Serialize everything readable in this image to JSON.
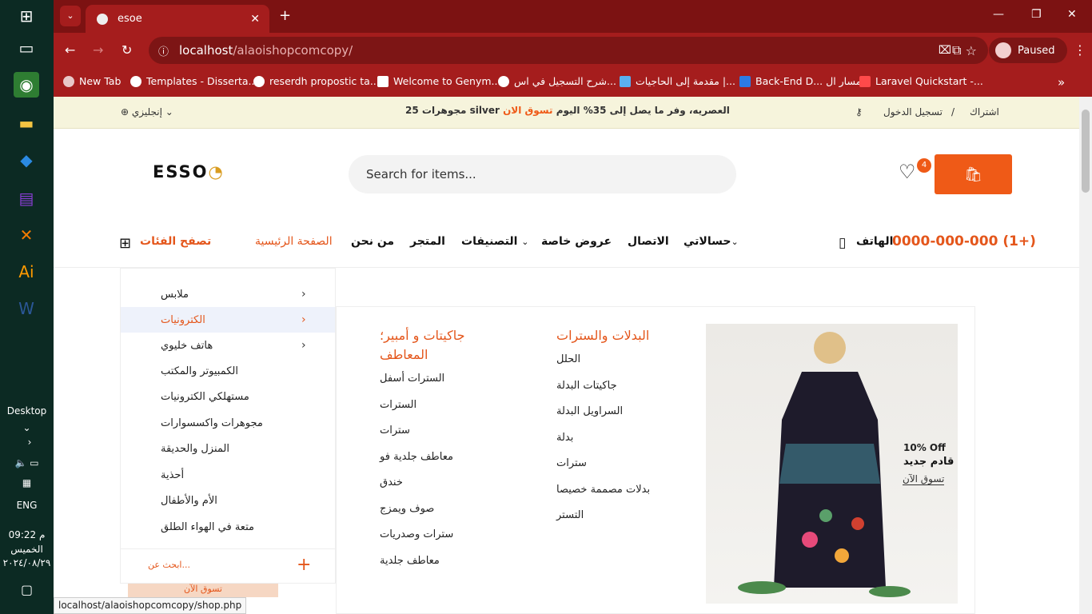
{
  "taskbar": {
    "desktop_label": "Desktop",
    "lang": "ENG",
    "time": "09:22 م",
    "day": "الخميس",
    "date": "٢٠٢٤/٠٨/٢٩"
  },
  "browser": {
    "tab_title": "esoe",
    "url_host": "localhost",
    "url_path": "/alaoishopcomcopy/",
    "profile_status": "Paused",
    "bookmarks": [
      "New Tab",
      "Templates - Disserta...",
      "reserdh propostic ta...",
      "Welcome to Genym...",
      "شرح التسجيل في اس...",
      "مقدمة إلى الحاجيات |...",
      "Back-End D... مسار ال",
      "Laravel Quickstart -..."
    ]
  },
  "topbar": {
    "language": "إنجليزي",
    "promo_prefix": "العصريه، وفر ما يصل إلى 35% اليوم",
    "promo_link": "تسوق الان",
    "promo_suffix": "silver مجوهرات 25",
    "login": "تسجيل الدخول",
    "separator": "/",
    "register": "اشتراك"
  },
  "header": {
    "logo": "ESSO",
    "search_placeholder": "Search for items...",
    "wishlist_count": "4"
  },
  "nav": {
    "browse": "تصفح الفئات",
    "items": [
      "الصفحة الرئيسية",
      "من نحن",
      "المتجر",
      "التصنيفات",
      "عروض خاصة",
      "الاتصال",
      "حسالاتي"
    ],
    "phone_label": "الهاتف",
    "phone": "0000-000-000 (1+)"
  },
  "categories": [
    "ملابس",
    "الكترونيات",
    "هاتف خليوي",
    "الكمبيوتر والمكتب",
    "مستهلكي الكترونيات",
    "مجوهرات واكسسوارات",
    "المنزل والحديقة",
    "أحذية",
    "الأم والأطفال",
    "متعة في الهواء الطلق"
  ],
  "cat_footer": {
    "search_label": "ابحث عن..."
  },
  "mega": {
    "col1_title": "جاكيتات و أمبير؛ المعاطف",
    "col1_items": [
      "السترات أسفل",
      "السترات",
      "سترات",
      "معاطف جلدية فو",
      "خندق",
      "صوف ويمزج",
      "سترات وصدريات",
      "معاطف جلدية"
    ],
    "col2_title": "البدلات والسترات",
    "col2_items": [
      "الحلل",
      "جاكيتات البدلة",
      "السراويل البدلة",
      "بدلة",
      "سترات",
      "بدلات مصممة خصيصا",
      "التستر"
    ],
    "promo_off": "10% Off",
    "promo_title": "قادم جديد",
    "promo_link": "تسوق الآن"
  },
  "below_btn": "تسوق الآن",
  "status_url": "localhost/alaoishopcomcopy/shop.php",
  "colors": {
    "accent": "#ef5a17",
    "chrome": "#a51d1d"
  }
}
